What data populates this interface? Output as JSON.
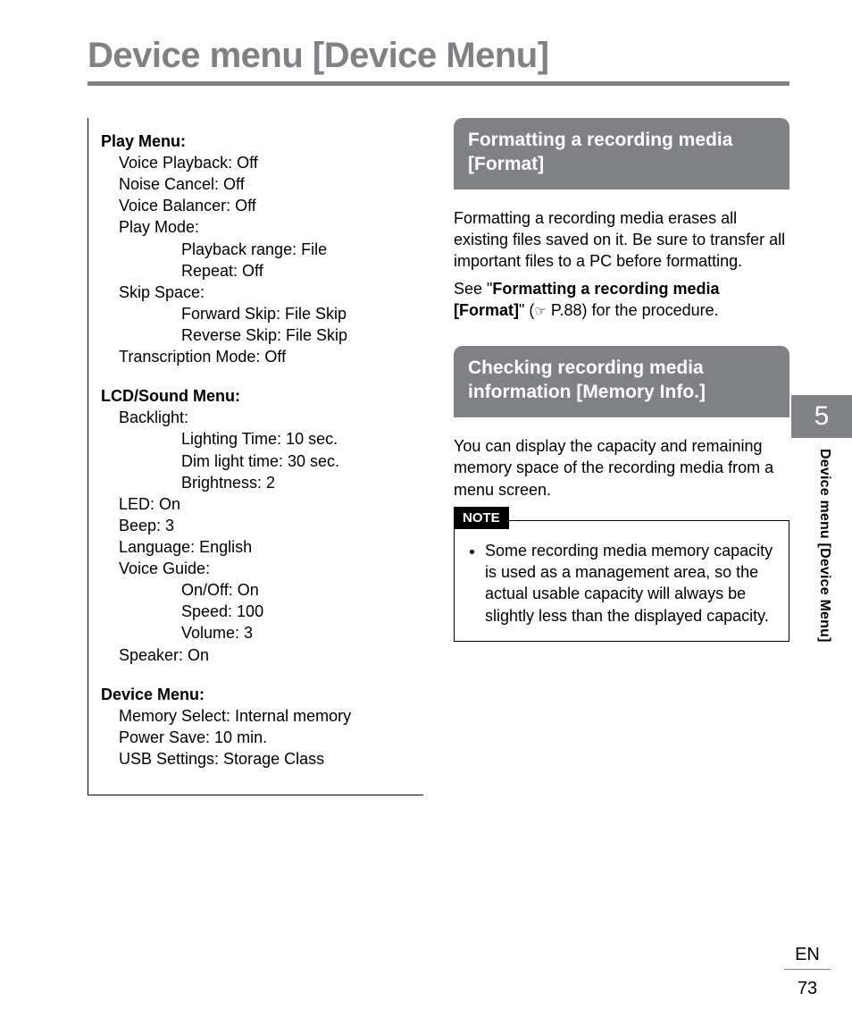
{
  "page_title": "Device menu [Device Menu]",
  "chapter_number": "5",
  "side_tab_text": "Device menu [Device Menu]",
  "footer": {
    "lang": "EN",
    "page": "73"
  },
  "settings": {
    "play": {
      "heading": "Play Menu:",
      "voice_playback": "Voice Playback: Off",
      "noise_cancel": "Noise Cancel: Off",
      "voice_balancer": "Voice Balancer: Off",
      "play_mode_label": "Play Mode:",
      "playback_range": "Playback range: File",
      "repeat": "Repeat: Off",
      "skip_space_label": "Skip Space:",
      "forward_skip": "Forward Skip: File Skip",
      "reverse_skip": "Reverse Skip: File Skip",
      "transcription_mode": "Transcription Mode: Off"
    },
    "lcd": {
      "heading": "LCD/Sound Menu:",
      "backlight_label": "Backlight:",
      "lighting_time": "Lighting Time: 10 sec.",
      "dim_light_time": "Dim light time: 30 sec.",
      "brightness": "Brightness: 2",
      "led": "LED: On",
      "beep": "Beep: 3",
      "language": "Language: English",
      "voice_guide_label": "Voice Guide:",
      "vg_onoff": "On/Off: On",
      "vg_speed": "Speed: 100",
      "vg_volume": "Volume: 3",
      "speaker": "Speaker: On"
    },
    "device": {
      "heading": "Device Menu:",
      "memory_select": "Memory Select: Internal memory",
      "power_save": "Power Save: 10 min.",
      "usb_settings": "USB Settings: Storage Class"
    }
  },
  "right": {
    "format_heading": "Formatting a recording media [Format]",
    "format_body": "Formatting a recording media erases all existing files saved on it. Be sure to transfer all important files to a PC before formatting.",
    "see_prefix": "See \"",
    "see_bold": "Formatting a recording media [Format]",
    "see_suffix_before_glyph": "\" (",
    "pointer_glyph": "☞",
    "see_suffix_after_glyph": " P.88) for the procedure.",
    "meminfo_heading": "Checking recording media information [Memory Info.]",
    "meminfo_body": "You can display the capacity and remaining memory space of the recording media from a menu screen.",
    "note_label": "NOTE",
    "note_bullet": "Some recording media memory capacity is used as a management area, so the actual usable capacity will always be slightly less than the displayed capacity."
  }
}
